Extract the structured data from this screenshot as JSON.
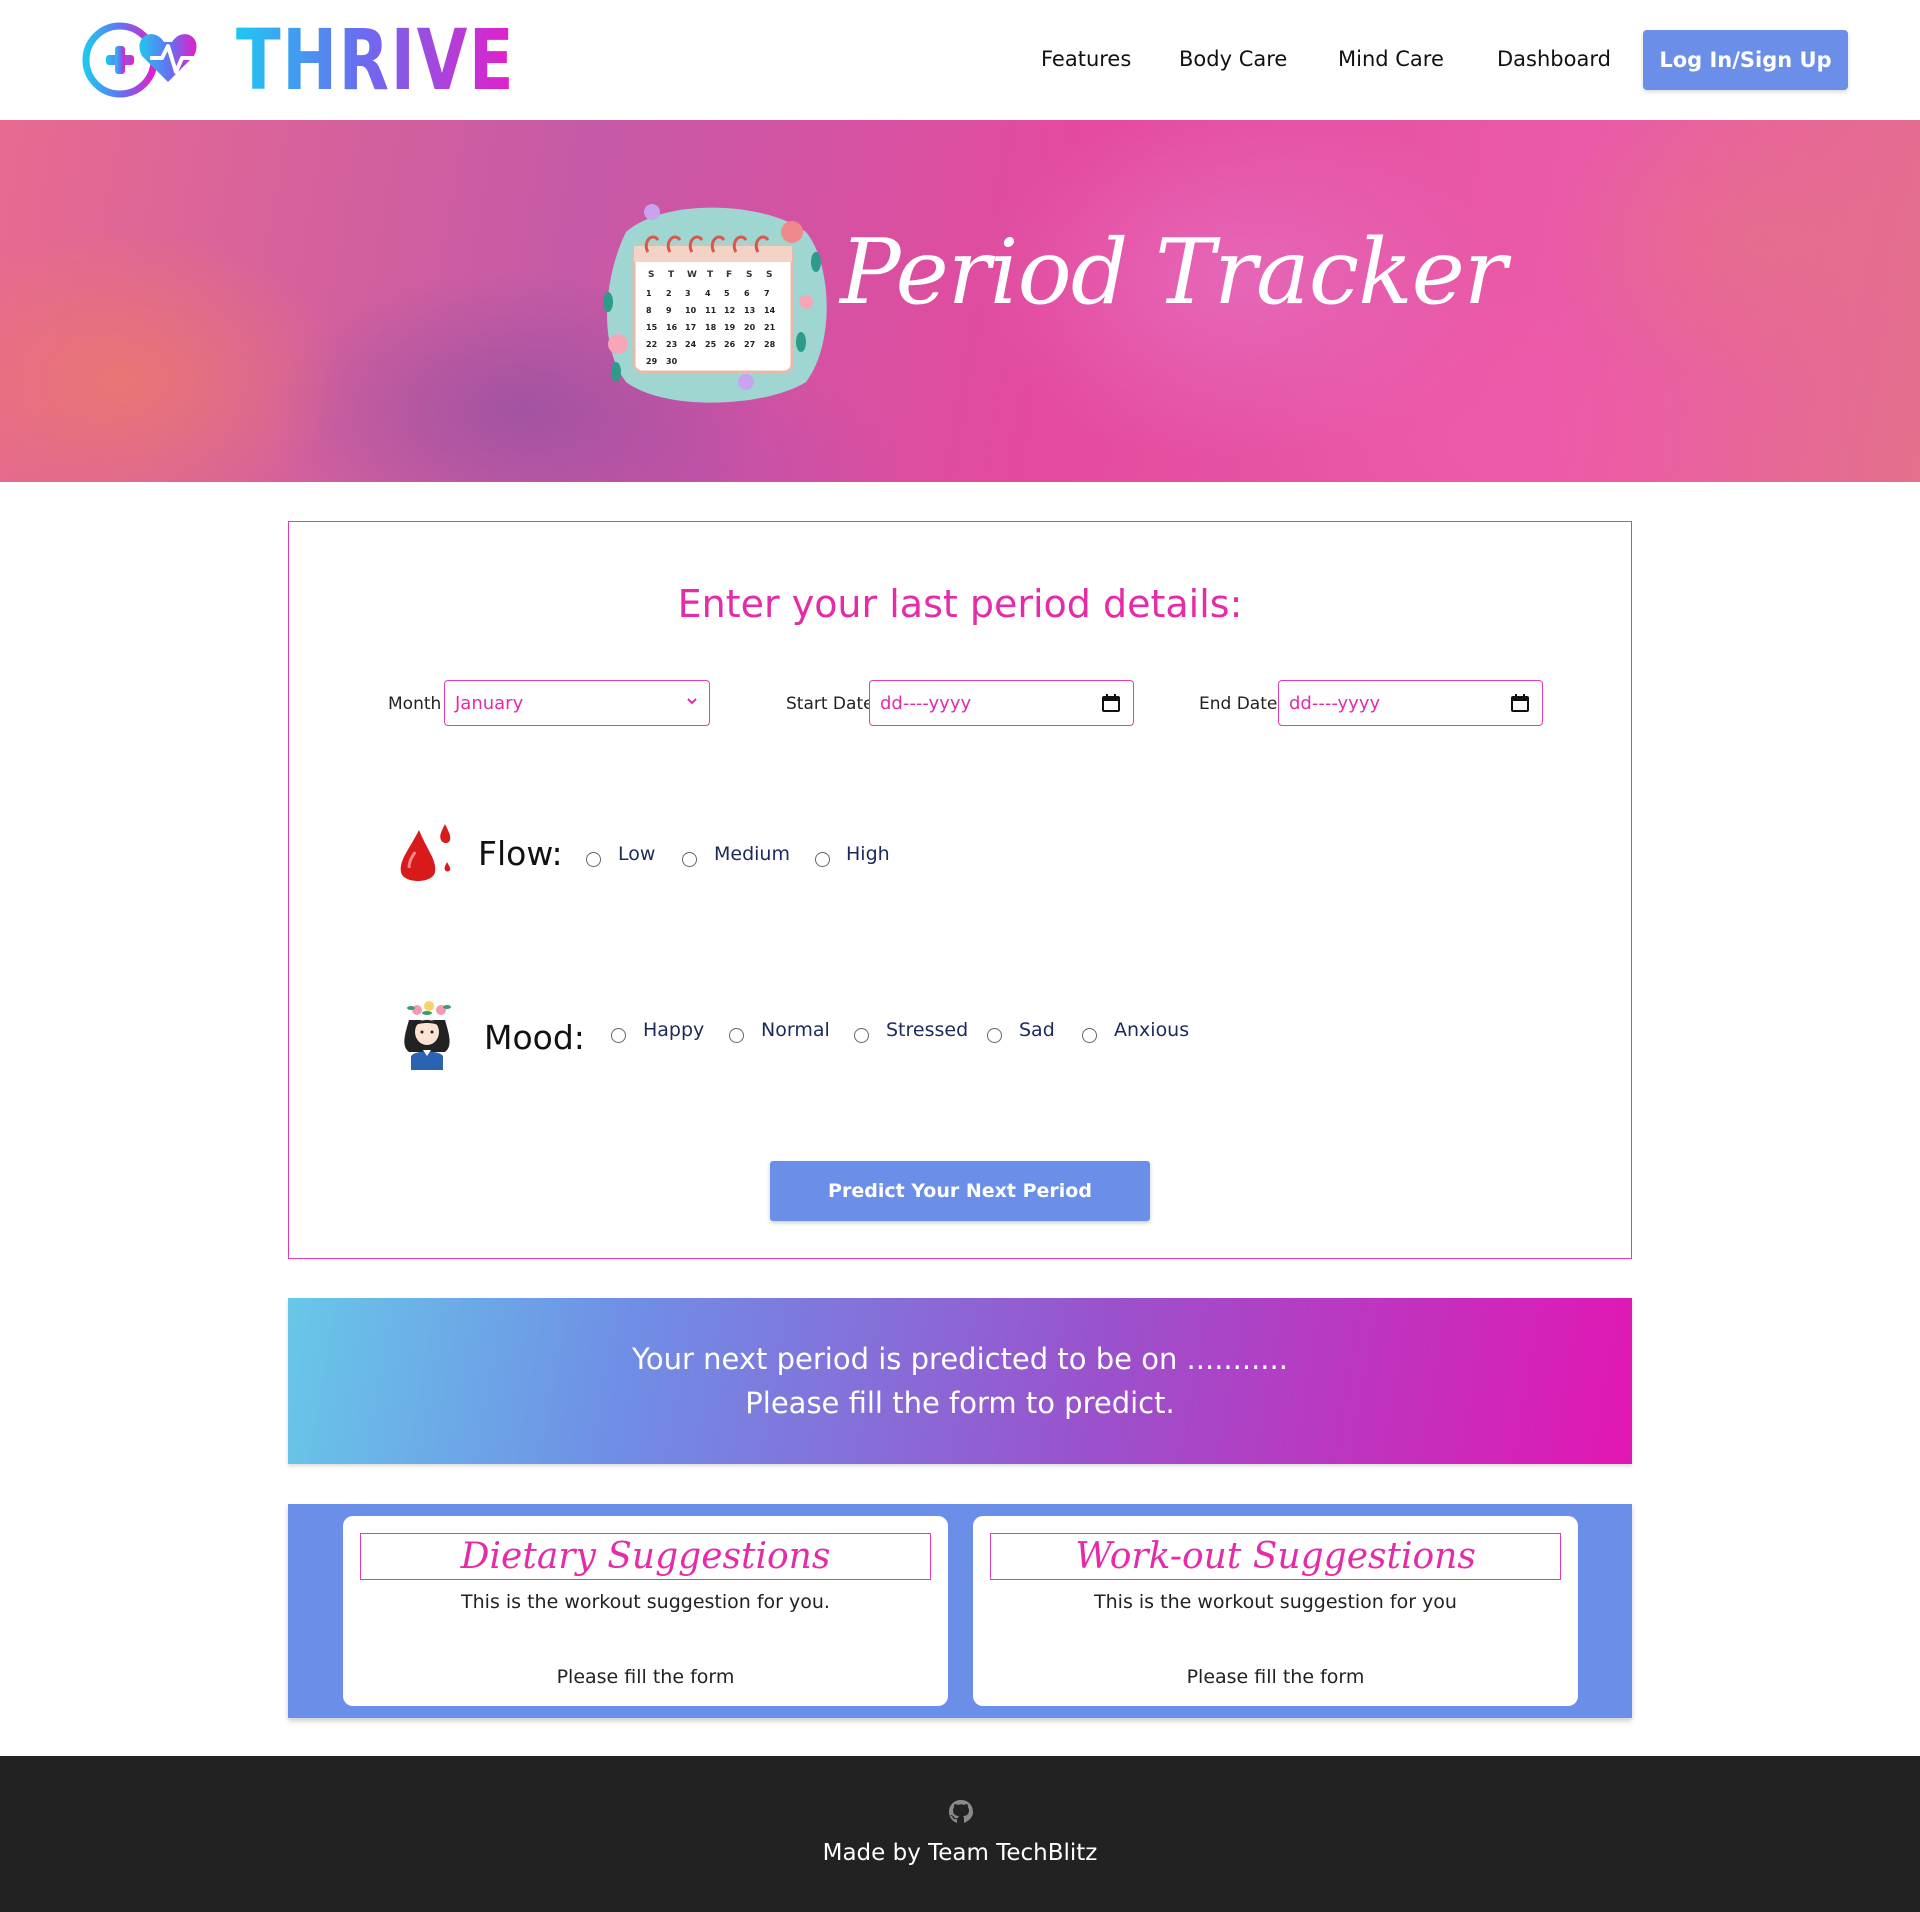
{
  "brand": {
    "name": "THRIVE"
  },
  "nav": {
    "links": [
      "Features",
      "Body Care",
      "Mind Care",
      "Dashboard"
    ],
    "login_label": "Log In/Sign Up"
  },
  "hero": {
    "title": "Period Tracker",
    "calendar": {
      "days_header": [
        "S",
        "T",
        "W",
        "T",
        "F",
        "S",
        "S"
      ],
      "dates": [
        "1",
        "2",
        "3",
        "4",
        "5",
        "6",
        "7",
        "8",
        "9",
        "10",
        "11",
        "12",
        "13",
        "14",
        "15",
        "16",
        "17",
        "18",
        "19",
        "20",
        "21",
        "22",
        "23",
        "24",
        "25",
        "26",
        "27",
        "28",
        "29",
        "30"
      ]
    }
  },
  "form": {
    "heading": "Enter your last period details:",
    "month_label": "Month",
    "month_value": "January",
    "start_label": "Start Date",
    "start_placeholder": "dd----yyyy",
    "end_label": "End Date",
    "end_placeholder": "dd----yyyy",
    "flow": {
      "label": "Flow:",
      "options": [
        "Low",
        "Medium",
        "High"
      ]
    },
    "mood": {
      "label": "Mood:",
      "options": [
        "Happy",
        "Normal",
        "Stressed",
        "Sad",
        "Anxious"
      ]
    },
    "predict_label": "Predict Your Next Period"
  },
  "prediction": {
    "line1": "Your next period is predicted to be on ...........",
    "line2": "Please fill the form to predict."
  },
  "suggestions": [
    {
      "title": "Dietary Suggestions",
      "text": "This is the workout suggestion for you.",
      "note": "Please fill the form"
    },
    {
      "title": "Work-out Suggestions",
      "text": "This is the workout suggestion for you",
      "note": "Please fill the form"
    }
  ],
  "footer": {
    "text": "Made by Team TechBlitz",
    "icon": "github-icon"
  },
  "colors": {
    "accent": "#e52ba8",
    "button": "#6b8fe8",
    "footer": "#222222"
  }
}
